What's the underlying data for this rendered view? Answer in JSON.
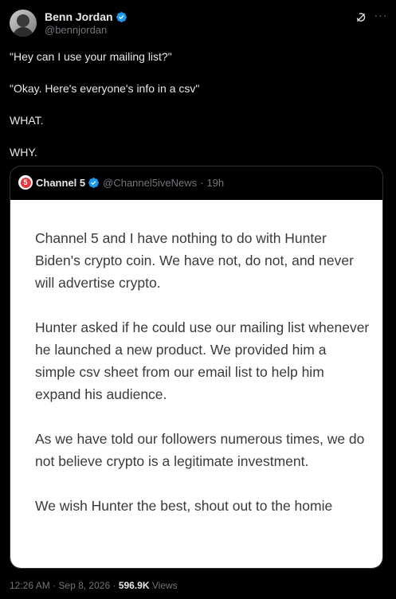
{
  "author": {
    "display_name": "Benn Jordan",
    "handle": "@bennjordan"
  },
  "post_text": [
    "\"Hey can I use your mailing list?\"",
    "\"Okay. Here's everyone's info in a csv\"",
    "WHAT.",
    "WHY."
  ],
  "quoted": {
    "display_name": "Channel 5",
    "handle": "@Channel5iveNews",
    "separator": "·",
    "time": "19h",
    "image_text": [
      "Channel 5 and I have nothing to do with Hunter Biden's crypto coin. We have not, do not, and never will advertise crypto.",
      "Hunter asked if he could use our mailing list whenever he launched a new product. We provided him a simple csv sheet from our email list to help him expand his audience.",
      "As we have told our followers numerous times, we do not believe crypto is a legitimate investment.",
      "We wish Hunter the best, shout out to the homie"
    ]
  },
  "footer": {
    "time": "12:26 AM",
    "sep1": "·",
    "date": "Sep 8, 2026",
    "sep2": "·",
    "views_count": "596.9K",
    "views_label": "Views"
  },
  "colors": {
    "background": "#000000",
    "verified_blue": "#1d9bf0",
    "muted": "#71767b",
    "channel5_red": "#e4383f"
  },
  "icons": [
    "verified-badge-icon",
    "grok-icon",
    "more-options-icon",
    "channel5-logo"
  ]
}
